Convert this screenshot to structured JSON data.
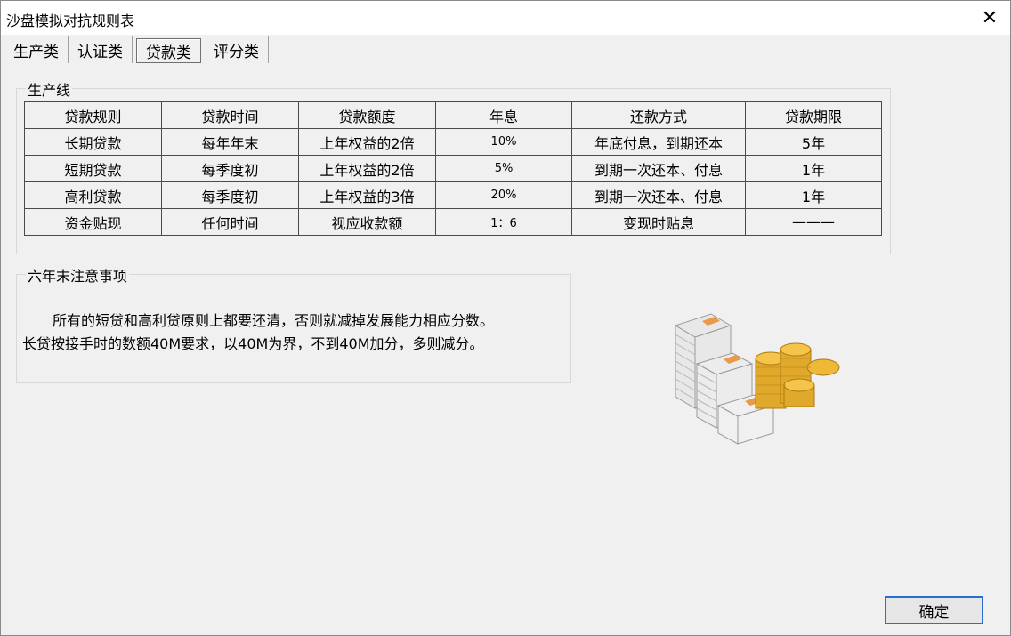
{
  "window": {
    "title": "沙盘模拟对抗规则表"
  },
  "tabs": [
    {
      "label": "生产类"
    },
    {
      "label": "认证类"
    },
    {
      "label": "贷款类"
    },
    {
      "label": "评分类"
    }
  ],
  "production_group": {
    "label": "生产线",
    "headers": [
      "贷款规则",
      "贷款时间",
      "贷款额度",
      "年息",
      "还款方式",
      "贷款期限"
    ],
    "rows": [
      [
        "长期贷款",
        "每年年末",
        "上年权益的2倍",
        "10%",
        "年底付息，到期还本",
        "5年"
      ],
      [
        "短期贷款",
        "每季度初",
        "上年权益的2倍",
        "5%",
        "到期一次还本、付息",
        "1年"
      ],
      [
        "高利贷款",
        "每季度初",
        "上年权益的3倍",
        "20%",
        "到期一次还本、付息",
        "1年"
      ],
      [
        "资金贴现",
        "任何时间",
        "视应收款额",
        "1：6",
        "变现时贴息",
        "———"
      ]
    ]
  },
  "notes_group": {
    "label": "六年末注意事项",
    "line1": "所有的短贷和高利贷原则上都要还清，否则就减掉发展能力相应分数。",
    "line2": "长贷按接手时的数额40M要求，以40M为界，不到40M加分，多则减分。"
  },
  "buttons": {
    "ok": "确定"
  }
}
